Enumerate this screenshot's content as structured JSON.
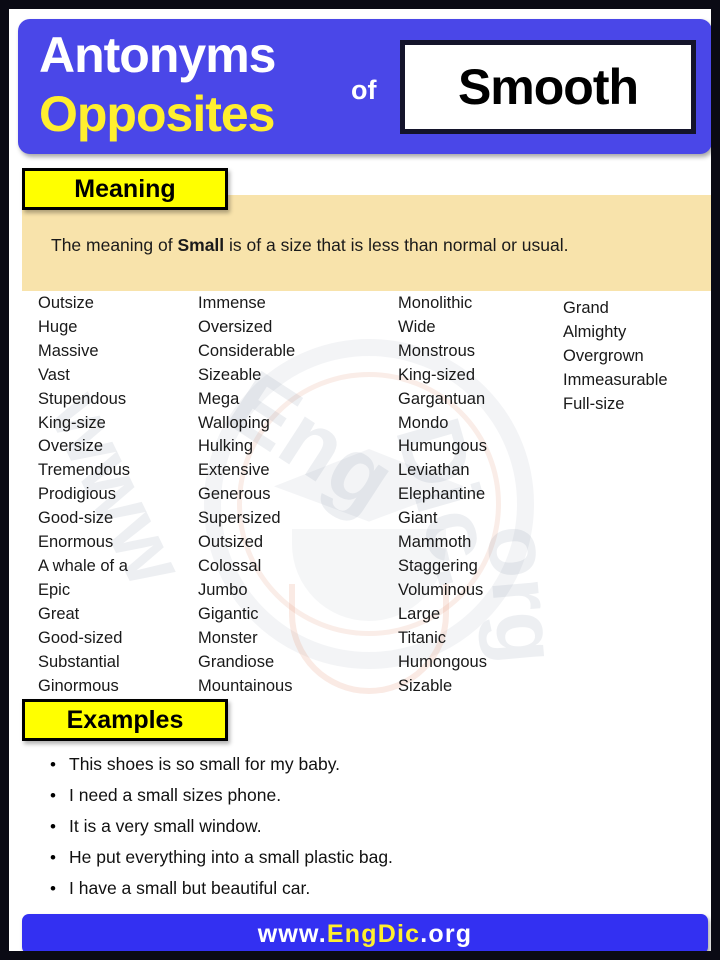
{
  "header": {
    "line1": "Antonyms",
    "line2": "Opposites",
    "connector": "of",
    "word": "Smooth"
  },
  "meaning": {
    "label": "Meaning",
    "text_before": "The meaning of ",
    "text_bold": "Small",
    "text_after": " is of a size that is less than normal or usual."
  },
  "words": {
    "columns": [
      [
        "Outsize",
        "Huge",
        "Massive",
        "Vast",
        "Stupendous",
        "King-size",
        "Oversize",
        "Tremendous",
        "Prodigious",
        "Good-size",
        "Enormous",
        "A whale of a",
        "Epic",
        "Great",
        "Good-sized",
        "Substantial",
        "Ginormous"
      ],
      [
        "Immense",
        "Oversized",
        "Considerable",
        "Sizeable",
        "Mega",
        "Walloping",
        "Hulking",
        "Extensive",
        "Generous",
        "Supersized",
        "Outsized",
        "Colossal",
        "Jumbo",
        "Gigantic",
        "Monster",
        "Grandiose",
        "Mountainous"
      ],
      [
        "Monolithic",
        "Wide",
        "Monstrous",
        "King-sized",
        "Gargantuan",
        "Mondo",
        "Humungous",
        "Leviathan",
        "Elephantine",
        "Giant",
        "Mammoth",
        "Staggering",
        "Voluminous",
        "Large",
        "Titanic",
        "Humongous",
        "Sizable"
      ],
      [
        "Grand",
        "Almighty",
        "Overgrown",
        "Immeasurable",
        "Full-size"
      ]
    ]
  },
  "examples": {
    "label": "Examples",
    "bullet": "•",
    "items": [
      "This shoes is so small for my baby.",
      "I need a small sizes phone.",
      "It is a very small window.",
      "He put everything into a small plastic bag.",
      "I have a small but beautiful car."
    ]
  },
  "footer": {
    "prefix": "www.",
    "brand": "EngDic",
    "suffix": ".org"
  },
  "watermark": {
    "w1": "www",
    "w2": "Eng",
    "w3": "Dic.",
    "w4": "org"
  },
  "colors": {
    "header_blue": "#4a47e8",
    "footer_blue": "#3330f2",
    "accent_yellow": "#ffff00",
    "title_yellow": "#ffef2e",
    "meaning_bg": "#f8e3ab",
    "border_black": "#0a0a14"
  }
}
